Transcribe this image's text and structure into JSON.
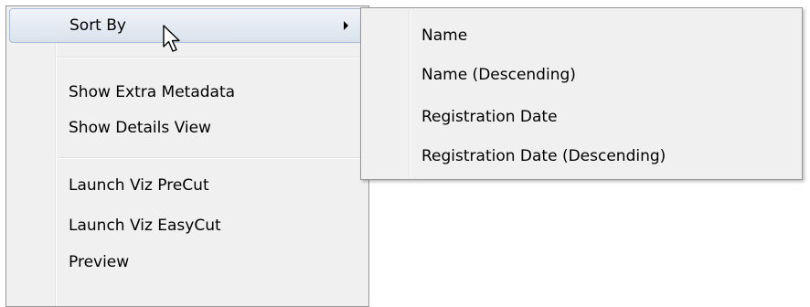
{
  "context_menu": {
    "sort_by": "Sort By",
    "show_extra_metadata": "Show Extra Metadata",
    "show_details_view": "Show Details View",
    "launch_viz_precut": "Launch Viz PreCut",
    "launch_viz_easycut": "Launch Viz EasyCut",
    "preview": "Preview"
  },
  "sort_submenu": {
    "items": [
      "Name",
      "Name (Descending)",
      "Registration Date",
      "Registration Date (Descending)"
    ]
  },
  "colors": {
    "menu_background": "#f0f0f0",
    "menu_border": "#979797",
    "highlight_border": "#a8bdd6"
  },
  "icons": {
    "submenu_arrow": "chevron-right-icon",
    "cursor": "mouse-pointer-icon"
  }
}
